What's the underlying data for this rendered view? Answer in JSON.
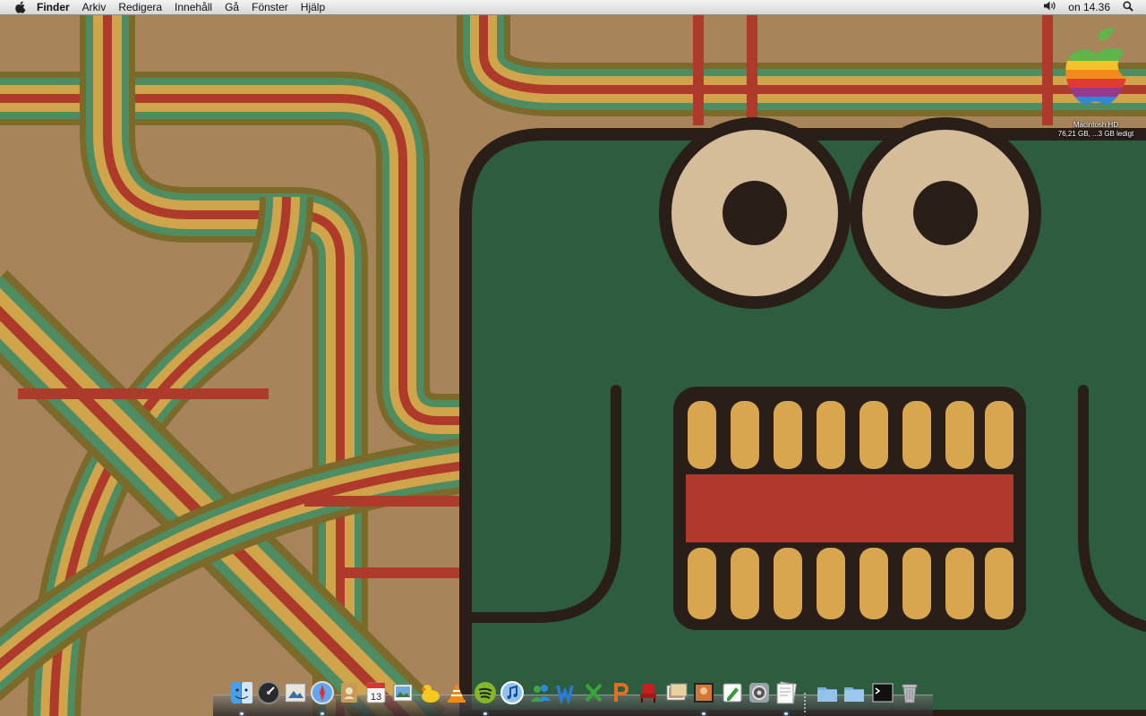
{
  "menubar": {
    "apple_icon": "apple-logo-icon",
    "app_name": "Finder",
    "menus": [
      "Arkiv",
      "Redigera",
      "Innehåll",
      "Gå",
      "Fönster",
      "Hjälp"
    ],
    "volume_icon": "speaker-volume-icon",
    "clock": "on 14.36",
    "spotlight_icon": "magnifier-icon"
  },
  "desktop": {
    "drive": {
      "name": "Macintosh HD",
      "info": "76,21 GB, ...3 GB ledigt",
      "icon": "rainbow-apple-drive-icon"
    }
  },
  "dock": {
    "items": [
      {
        "icon": "finder-icon",
        "running": true
      },
      {
        "icon": "dashboard-icon",
        "running": false
      },
      {
        "icon": "mail-stamp-icon",
        "running": false
      },
      {
        "icon": "safari-compass-icon",
        "running": true
      },
      {
        "icon": "address-book-icon",
        "running": false
      },
      {
        "icon": "ical-calendar-icon",
        "running": false,
        "text": "13"
      },
      {
        "icon": "iphoto-icon",
        "running": false
      },
      {
        "icon": "cyberduck-duck-icon",
        "running": false
      },
      {
        "icon": "vlc-cone-icon",
        "running": false
      },
      {
        "icon": "spotify-icon",
        "running": true
      },
      {
        "icon": "itunes-icon",
        "running": false
      },
      {
        "icon": "messenger-people-icon",
        "running": false
      },
      {
        "icon": "word-w-icon",
        "running": false
      },
      {
        "icon": "excel-x-icon",
        "running": false
      },
      {
        "icon": "powerpoint-p-icon",
        "running": false
      },
      {
        "icon": "red-chair-icon",
        "running": false
      },
      {
        "icon": "preview-photos-icon",
        "running": false
      },
      {
        "icon": "photo-booth-icon",
        "running": true
      },
      {
        "icon": "textedit-pen-icon",
        "running": false
      },
      {
        "icon": "system-preferences-icon",
        "running": false
      },
      {
        "icon": "textedit-pages-icon",
        "running": true
      },
      {
        "icon": "applications-folder-icon",
        "running": false
      },
      {
        "icon": "documents-folder-icon",
        "running": false
      },
      {
        "icon": "terminal-icon",
        "running": false
      },
      {
        "icon": "trash-icon",
        "running": false
      }
    ]
  },
  "colors": {
    "paper": "#a7845a",
    "stripe_green": "#4e8c62",
    "stripe_yellow": "#cfa44a",
    "stripe_red": "#ad3a2a",
    "stripe_olive": "#7c6a2a",
    "monster_green": "#2d5d3e",
    "outline": "#2a1f18",
    "tooth": "#d8a64e",
    "mouth_red": "#b0392e",
    "eye_white": "#d4bd98"
  }
}
